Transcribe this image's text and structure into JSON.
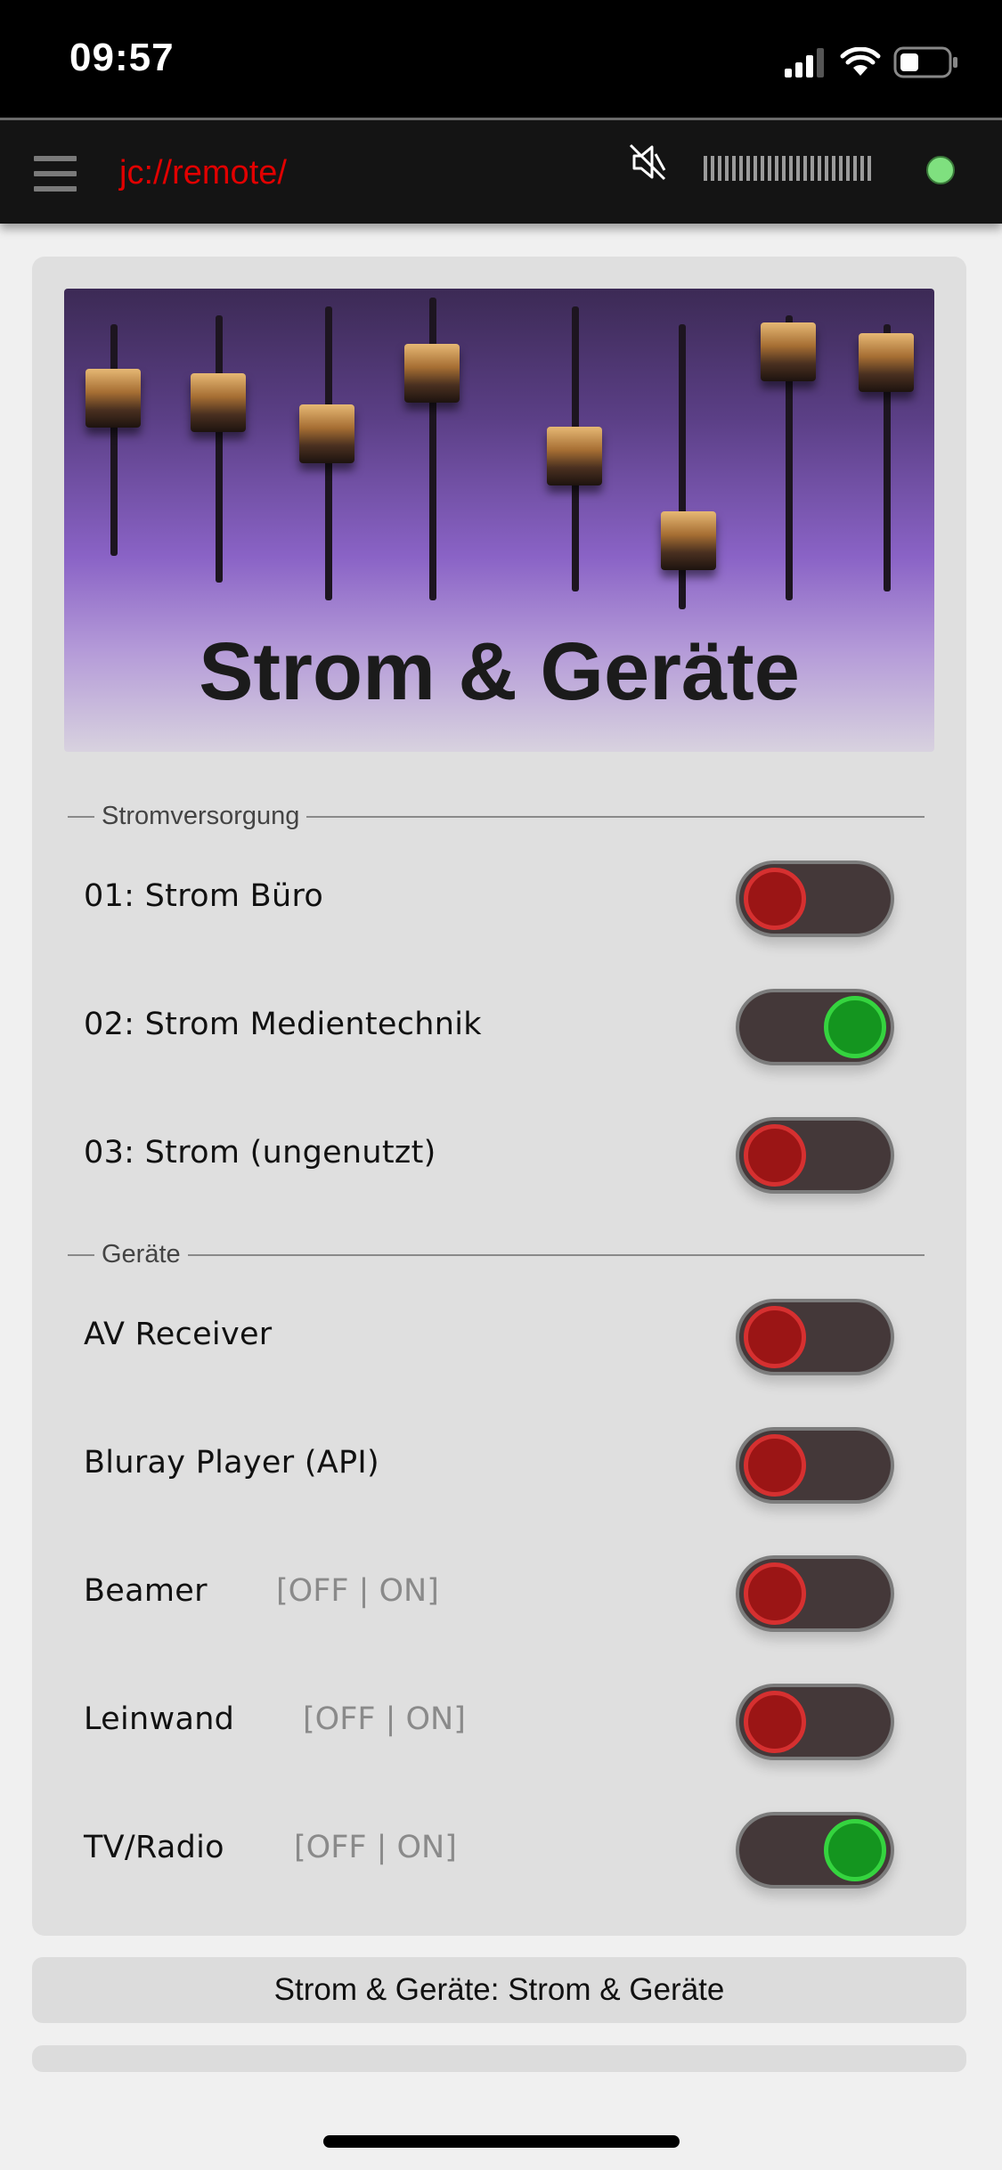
{
  "status_bar": {
    "time": "09:57"
  },
  "app": {
    "title": "jc://remote/"
  },
  "hero": {
    "title": "Strom & Geräte"
  },
  "sections": [
    {
      "legend": "Stromversorgung",
      "rows": [
        {
          "label": "01: Strom Büro",
          "hint": "",
          "on": false
        },
        {
          "label": "02: Strom Medientechnik",
          "hint": "",
          "on": true
        },
        {
          "label": "03: Strom (ungenutzt)",
          "hint": "",
          "on": false
        }
      ]
    },
    {
      "legend": "Geräte",
      "rows": [
        {
          "label": "AV Receiver",
          "hint": "",
          "on": false
        },
        {
          "label": "Bluray Player (API)",
          "hint": "",
          "on": false
        },
        {
          "label": "Beamer",
          "hint": "[OFF | ON]",
          "on": false
        },
        {
          "label": "Leinwand",
          "hint": "[OFF | ON]",
          "on": false
        },
        {
          "label": "TV/Radio",
          "hint": "[OFF | ON]",
          "on": true
        }
      ]
    }
  ],
  "footer": {
    "text": "Strom & Geräte: Strom & Geräte"
  },
  "colors": {
    "accent": "#e10000",
    "toggle_on": "#14951f",
    "toggle_off": "#9b1515",
    "connection": "#7fe07f"
  }
}
